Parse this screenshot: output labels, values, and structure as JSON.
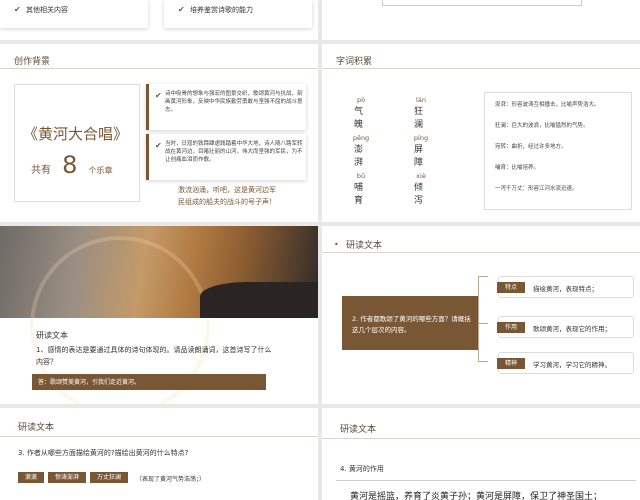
{
  "slide1": {
    "items": [
      "其他相关内容",
      "培养鉴赏诗歌的能力"
    ]
  },
  "slide2": {
    "title": "创作背景",
    "book_title": "《黄河大合唱》",
    "movements_prefix": "共有",
    "movements_count": "8",
    "movements_suffix": "个乐章",
    "point1": "诗中吸骨的想象与强宏的图景交织，歌颂黄河与抗战，刻画黄河形象，反映中华民族勤劳勇敢与坚强不屈的战斗意志。",
    "point2": "当时，日寇的铁蹄肆虐践踏着中华大地，诗人随八路军转战在黄河边，目睹壮丽的山河，伟大而坚强的军民，为不让创痛血泪而作歌。",
    "caption_line1": "激流汹涌，听吧，这是黄河边军",
    "caption_line2": "民组成的船夫的战斗的号子声！"
  },
  "slide3": {
    "title": "字词积累",
    "words": [
      {
        "pinyin": "pò",
        "word": "气 魄"
      },
      {
        "pinyin": "lán",
        "word": "狂 澜"
      },
      {
        "pinyin": "pēng",
        "word": "澎 湃"
      },
      {
        "pinyin": "píng",
        "word": "屏 障"
      },
      {
        "pinyin": "bǔ",
        "word": "哺 育"
      },
      {
        "pinyin": "xiè",
        "word": "倾 泻"
      }
    ],
    "definitions": [
      "澎湃：形容波涛互相撞击，比喻声势浩大。",
      "狂澜：巨大的波浪，比喻猛烈的气势。",
      "宛转：曲折，经过许多地方。",
      "哺育：比喻培养。",
      "一泻千万丈：形容江河水流迅速。"
    ]
  },
  "slide4": {
    "label": "研读文本",
    "question": "1、感情的表达是要通过具体的诗句体现的。请品读朗诵词，这首诗写了什么内容？",
    "answer": "答：歌颂赞美黄河，引我们走近黄河。"
  },
  "slide5": {
    "title": "研读文本",
    "center_q": "2. 作者都歌颂了黄河的哪些方面？请概括这几个层次的内容。",
    "rows": [
      {
        "tag": "特点",
        "text": "描绘黄河，表现特点；"
      },
      {
        "tag": "作用",
        "text": "歌颂黄河，表现它的作用；"
      },
      {
        "tag": "精神",
        "text": "学习黄河，学习它的精神。"
      }
    ]
  },
  "slide6": {
    "title": "研读文本",
    "question": "3. 作者从哪些方面描绘黄河的?描绘出黄河的什么特点?",
    "tags": [
      "滚滚",
      "惊涛澎湃",
      "万丈狂澜"
    ],
    "note": "（表现了黄河气势浩荡；）"
  },
  "slide7": {
    "title": "研读文本",
    "subtitle": "4. 黄河的作用",
    "text": "黄河是摇篮，养育了炎黄子孙；黄河是屏障，保卫了神圣国土；"
  },
  "colors": {
    "accent": "#7a5734",
    "background": "#eae8e6"
  }
}
